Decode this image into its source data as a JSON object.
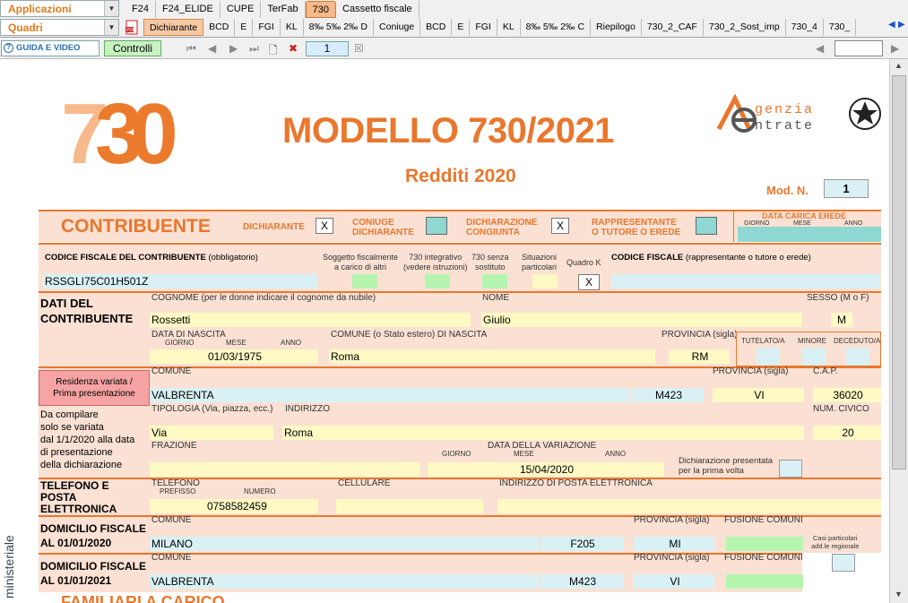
{
  "topbar": {
    "app_selector": "Applicazioni",
    "quadri_selector": "Quadri",
    "app_tabs": [
      "F24",
      "F24_ELIDE",
      "CUPE",
      "TerFab",
      "730",
      "Cassetto fiscale"
    ],
    "active_app_tab": "730",
    "quadri_tabs": [
      "Dichiarante",
      "BCD",
      "E",
      "FGI",
      "KL",
      "8‰ 5‰ 2‰ D",
      "Coniuge",
      "BCD",
      "E",
      "FGI",
      "KL",
      "8‰ 5‰ 2‰ C",
      "Riepilogo",
      "730_2_CAF",
      "730_2_Sost_imp",
      "730_4",
      "730_"
    ]
  },
  "navbar": {
    "guida_label": "GUIDA E VIDEO",
    "controlli_label": "Controlli",
    "page_number": "1"
  },
  "form": {
    "logo_number": "730",
    "title": "MODELLO 730/2021",
    "subtitle": "Redditi 2020",
    "agency_line1": "genzia",
    "agency_line2": "ntrate",
    "mod_n_label": "Mod. N.",
    "mod_n_value": "1",
    "contribuente": {
      "title": "CONTRIBUENTE",
      "dichiarante_label": "DICHIARANTE",
      "dichiarante_value": "X",
      "coniuge_label_1": "CONIUGE",
      "coniuge_label_2": "DICHIARANTE",
      "congiunta_label_1": "DICHIARAZIONE",
      "congiunta_label_2": "CONGIUNTA",
      "congiunta_value": "X",
      "rappresentante_label_1": "RAPPRESENTANTE",
      "rappresentante_label_2": "O TUTORE O EREDE",
      "data_carica_label": "DATA CARICA EREDE",
      "giorno": "GIORNO",
      "mese": "MESE",
      "anno": "ANNO"
    },
    "codice_fiscale": {
      "label": "CODICE FISCALE DEL CONTRIBUENTE",
      "label_note": "(obbligatorio)",
      "value": "RSSGLI75C01H501Z",
      "soggetto_label_1": "Soggetto fiscalmente",
      "soggetto_label_2": "a carico di altri",
      "integrativo_label_1": "730 integrativo",
      "integrativo_label_2": "(vedere istruzioni)",
      "senza_sostituto_label_1": "730 senza",
      "senza_sostituto_label_2": "sostituto",
      "situazioni_label_1": "Situazioni",
      "situazioni_label_2": "particolari",
      "quadro_k_label": "Quadro K",
      "quadro_k_value": "X",
      "cf_rappresentante_label": "CODICE FISCALE",
      "cf_rappresentante_note": "(rappresentante o tutore o erede)"
    },
    "dati": {
      "section_label_1": "DATI DEL",
      "section_label_2": "CONTRIBUENTE",
      "cognome_label": "COGNOME (per le donne indicare il cognome da nubile)",
      "cognome": "Rossetti",
      "nome_label": "NOME",
      "nome": "Giulio",
      "sesso_label": "SESSO (M o F)",
      "sesso": "M",
      "nascita_label": "DATA DI NASCITA",
      "giorno": "GIORNO",
      "mese": "MESE",
      "anno": "ANNO",
      "data_nascita": "01/03/1975",
      "comune_nascita_label": "COMUNE (o Stato estero) DI NASCITA",
      "comune_nascita": "Roma",
      "provincia_label": "PROVINCIA (sigla)",
      "provincia": "RM",
      "tutelato_label": "TUTELATO/A",
      "minore_label": "MINORE",
      "deceduto_label": "DECEDUTO/A"
    },
    "residenza": {
      "button_label_1": "Residenza variata /",
      "button_label_2": "Prima presentazione",
      "side_note": [
        "Da compilare",
        "solo se variata",
        "dal 1/1/2020 alla data",
        "di presentazione",
        "della dichiarazione"
      ],
      "comune_label": "COMUNE",
      "comune": "VALBRENTA",
      "codice_comune": "M423",
      "provincia_label": "PROVINCIA (sigla)",
      "provincia": "VI",
      "cap_label": "C.A.P.",
      "cap": "36020",
      "tipologia_label": "TIPOLOGIA (Via, piazza, ecc.)",
      "tipologia": "Via",
      "indirizzo_label": "INDIRIZZO",
      "indirizzo": "Roma",
      "civico_label": "NUM. CIVICO",
      "civico": "20",
      "frazione_label": "FRAZIONE",
      "data_variazione_label": "DATA DELLA VARIAZIONE",
      "giorno": "GIORNO",
      "mese": "MESE",
      "anno": "ANNO",
      "data_variazione": "15/04/2020",
      "prima_volta_label_1": "Dichiarazione presentata",
      "prima_volta_label_2": "per la prima volta"
    },
    "telefono": {
      "section_label_1": "TELEFONO E",
      "section_label_2": "POSTA",
      "section_label_3": "ELETTRONICA",
      "telefono_label": "TELEFONO",
      "prefisso_label": "PREFISSO",
      "numero_label": "NUMERO",
      "numero": "0758582459",
      "cellulare_label": "CELLULARE",
      "email_label": "INDIRIZZO DI POSTA ELETTRONICA"
    },
    "domicilio_2020": {
      "section_label_1": "DOMICILIO FISCALE",
      "section_label_2": "AL 01/01/2020",
      "comune_label": "COMUNE",
      "comune": "MILANO",
      "codice": "F205",
      "provincia_label": "PROVINCIA (sigla)",
      "provincia": "MI",
      "fusione_label": "FUSIONE COMUNI",
      "casi_label_1": "Casi particolari",
      "casi_label_2": "add.le regionale"
    },
    "domicilio_2021": {
      "section_label_1": "DOMICILIO FISCALE",
      "section_label_2": "AL 01/01/2021",
      "comune_label": "COMUNE",
      "comune": "VALBRENTA",
      "codice": "M423",
      "provincia_label": "PROVINCIA (sigla)",
      "provincia": "VI",
      "fusione_label": "FUSIONE COMUNI"
    },
    "familiari_partial": "FAMILIARI A CARICO",
    "side_vertical_label": "ministeriale"
  }
}
